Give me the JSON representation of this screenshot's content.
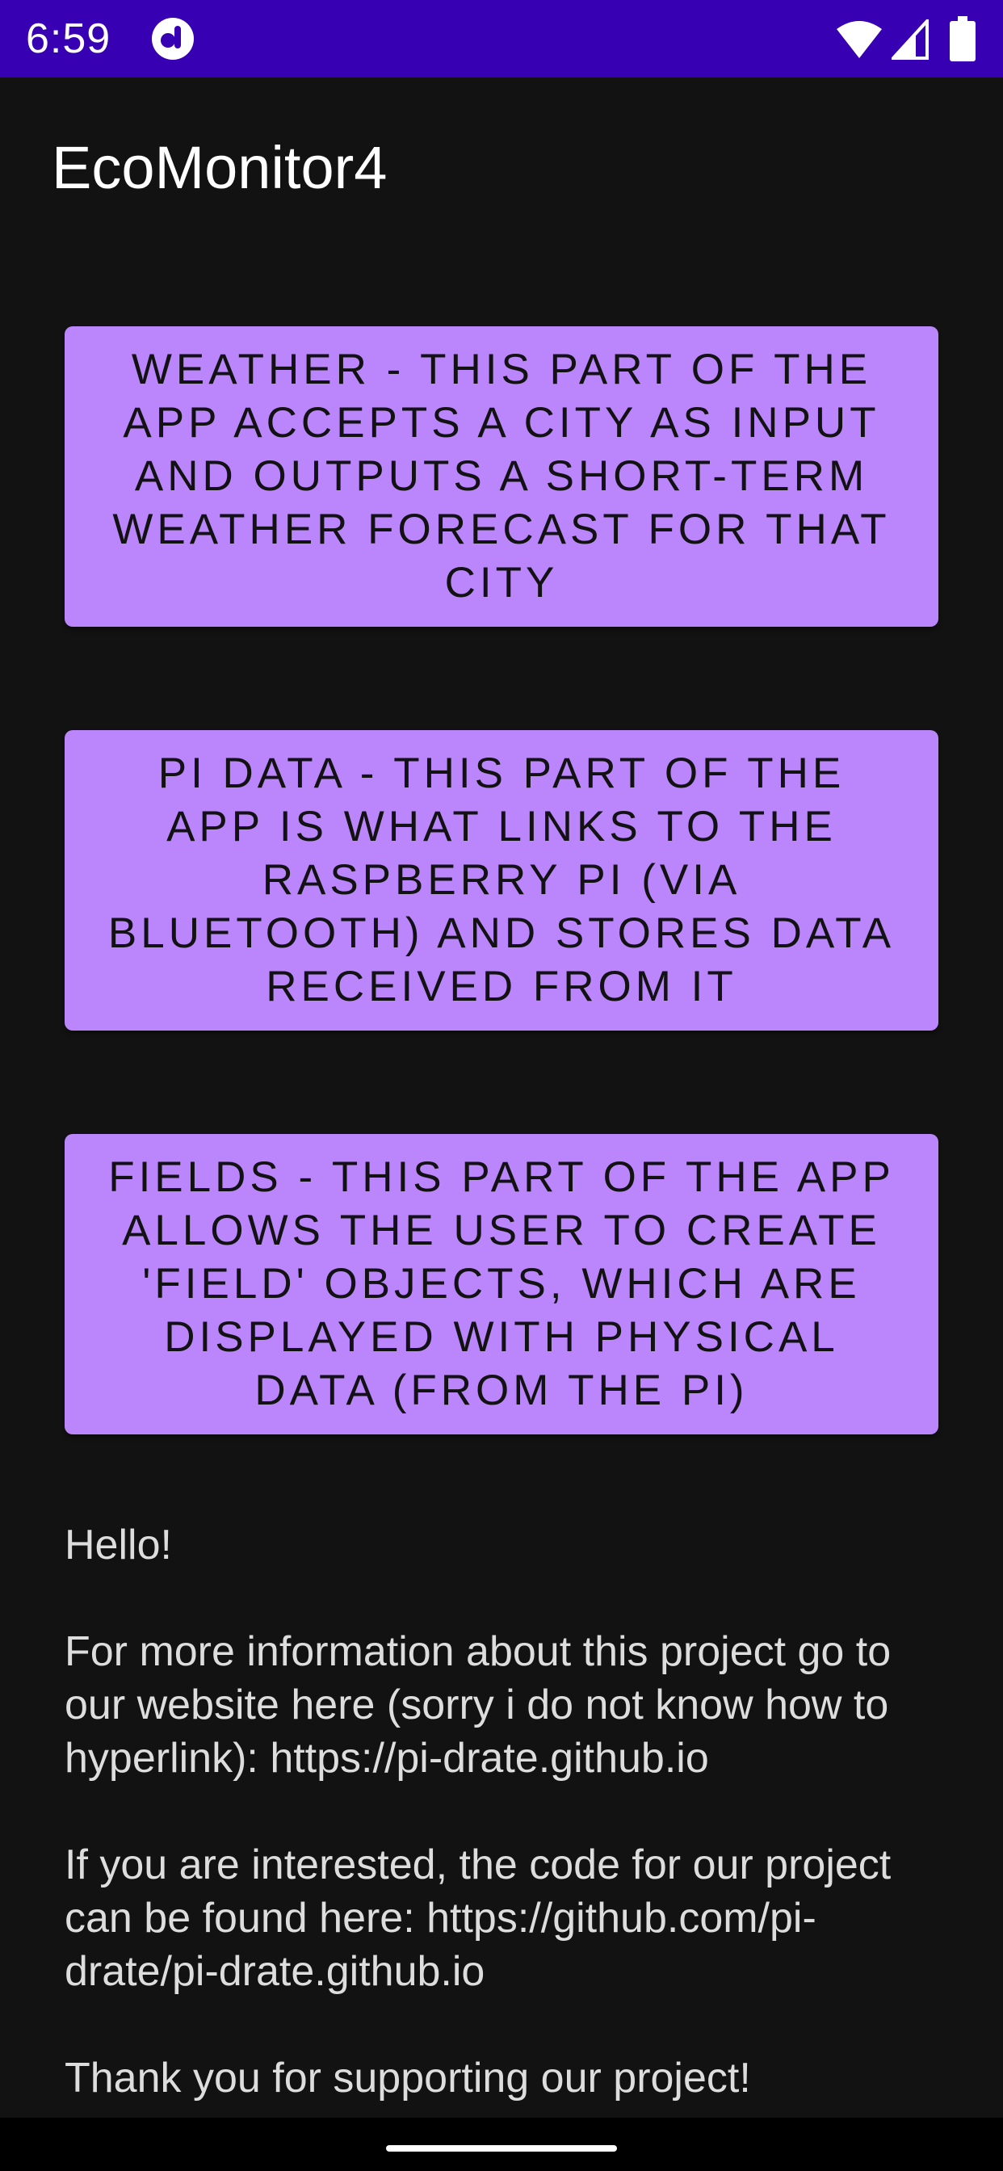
{
  "status_bar": {
    "time": "6:59",
    "background": "#3700B3",
    "icons": [
      "app-notification-icon",
      "wifi-icon",
      "signal-icon",
      "battery-icon"
    ]
  },
  "app_bar": {
    "title": "EcoMonitor4"
  },
  "buttons": {
    "weather": "WEATHER - THIS PART OF THE APP ACCEPTS A CITY AS INPUT AND OUTPUTS A SHORT-TERM WEATHER FORECAST FOR THAT CITY",
    "pi_data": "PI DATA - THIS PART OF THE APP IS WHAT LINKS TO THE RASPBERRY PI (VIA BLUETOOTH) AND STORES DATA RECEIVED FROM IT",
    "fields": "FIELDS - THIS PART OF THE APP ALLOWS THE USER TO CREATE 'FIELD' OBJECTS, WHICH ARE DISPLAYED WITH PHYSICAL DATA (FROM THE PI)"
  },
  "info": {
    "greeting": "Hello!",
    "website_text": "For more information about this project go to our website here (sorry i do not know how to hyperlink): https://pi-drate.github.io",
    "code_text": "If you are interested, the code for our project can be found here: https://github.com/pi-drate/pi-drate.github.io",
    "thanks": "Thank you for supporting our project!"
  },
  "colors": {
    "accent": "#BB86FC",
    "background": "#121212",
    "status_bar": "#3700B3"
  }
}
